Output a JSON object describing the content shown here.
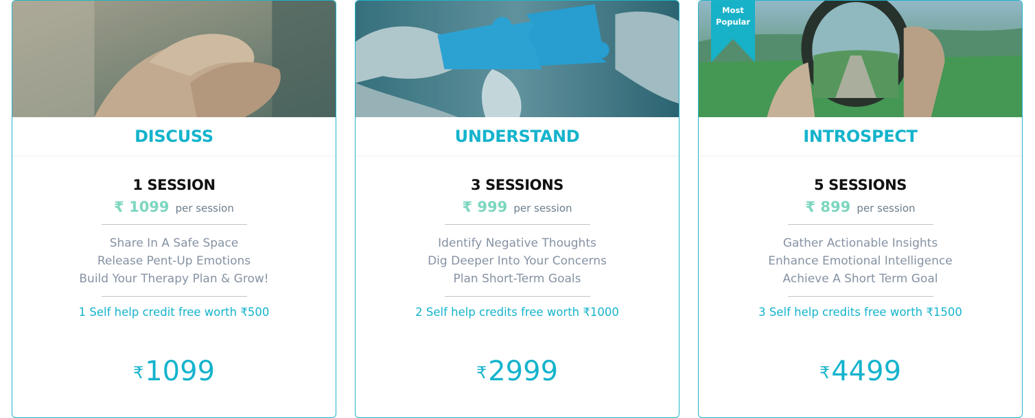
{
  "plans": [
    {
      "name": "DISCUSS",
      "sessions": "1 SESSION",
      "rate": "₹ 1099",
      "per": "per session",
      "benefits": [
        "Share In A Safe Space",
        "Release Pent-Up Emotions",
        "Build Your Therapy Plan & Grow!"
      ],
      "credit": "1 Self help credit free worth ₹500",
      "currency": "₹",
      "price": "1099"
    },
    {
      "name": "UNDERSTAND",
      "sessions": "3 SESSIONS",
      "rate": "₹ 999",
      "per": "per session",
      "benefits": [
        "Identify Negative Thoughts",
        "Dig Deeper Into Your Concerns",
        "Plan Short-Term Goals"
      ],
      "credit": "2 Self help credits free worth ₹1000",
      "currency": "₹",
      "price": "2999"
    },
    {
      "name": "INTROSPECT",
      "sessions": "5 SESSIONS",
      "rate": "₹ 899",
      "per": "per session",
      "benefits": [
        "Gather Actionable Insights",
        "Enhance Emotional Intelligence",
        "Achieve A Short Term Goal"
      ],
      "credit": "3 Self help credits free worth ₹1500",
      "currency": "₹",
      "price": "4499",
      "badge": [
        "Most",
        "Popular"
      ]
    }
  ],
  "colors": {
    "accent": "#15b3cc",
    "rate": "#7dd6bf",
    "text_muted": "#8592a3"
  }
}
